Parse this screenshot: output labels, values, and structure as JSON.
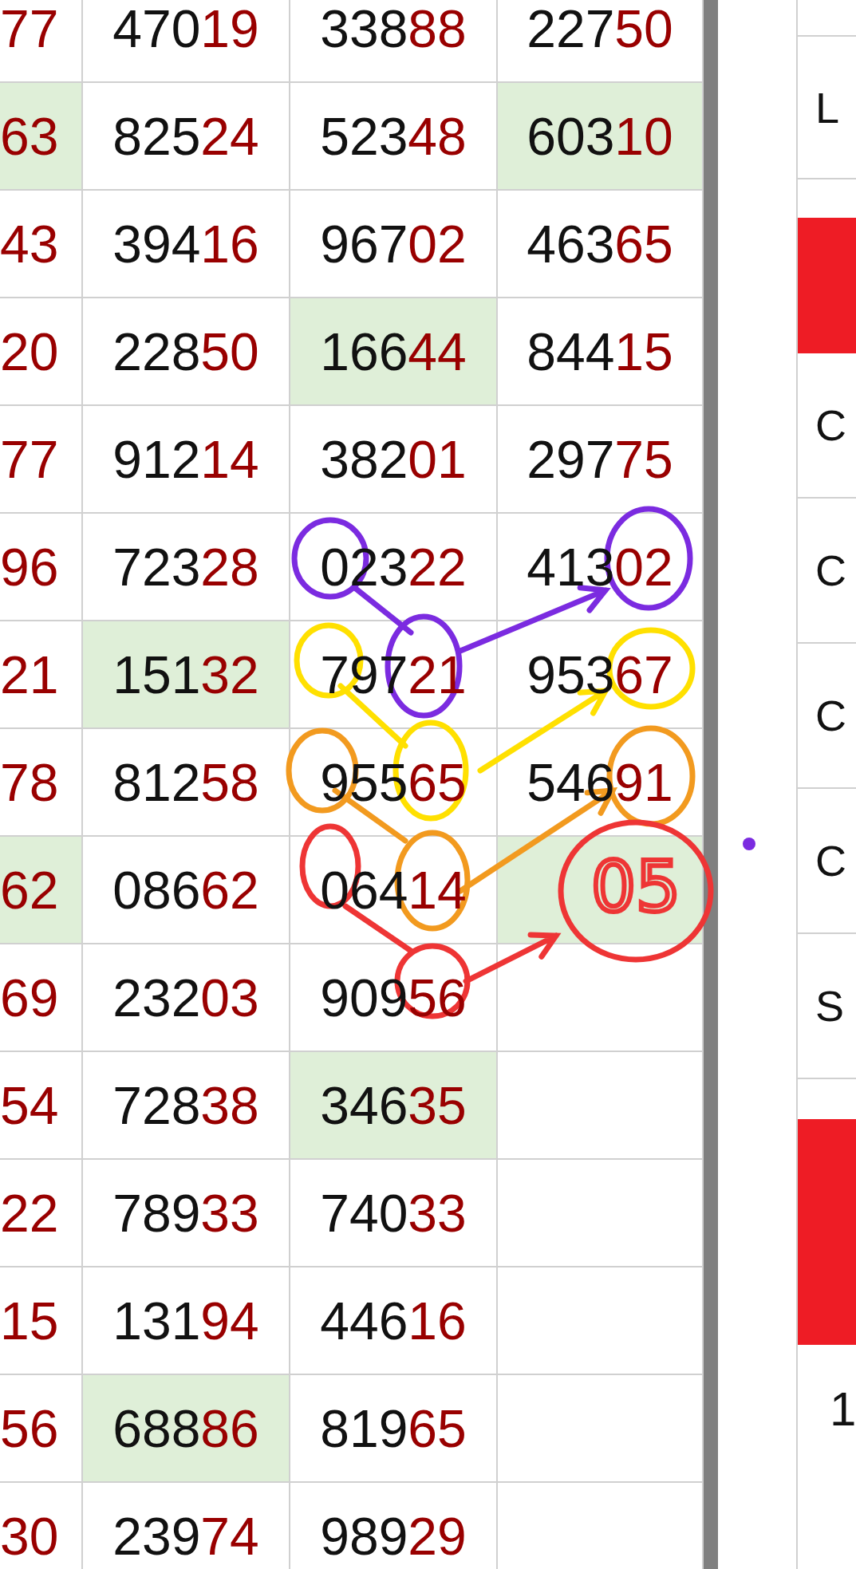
{
  "table": {
    "rows": [
      {
        "cells": [
          {
            "tail": "77",
            "highlighted": false
          },
          {
            "head": "470",
            "tail": "19",
            "highlighted": false
          },
          {
            "head": "338",
            "tail": "88",
            "highlighted": false
          },
          {
            "head": "227",
            "tail": "50",
            "highlighted": false
          }
        ]
      },
      {
        "cells": [
          {
            "tail": "63",
            "highlighted": true
          },
          {
            "head": "825",
            "tail": "24",
            "highlighted": false
          },
          {
            "head": "523",
            "tail": "48",
            "highlighted": false
          },
          {
            "head": "603",
            "tail": "10",
            "highlighted": true
          }
        ]
      },
      {
        "cells": [
          {
            "tail": "43",
            "highlighted": false
          },
          {
            "head": "394",
            "tail": "16",
            "highlighted": false
          },
          {
            "head": "967",
            "tail": "02",
            "highlighted": false
          },
          {
            "head": "463",
            "tail": "65",
            "highlighted": false
          }
        ]
      },
      {
        "cells": [
          {
            "tail": "20",
            "highlighted": false
          },
          {
            "head": "228",
            "tail": "50",
            "highlighted": false
          },
          {
            "head": "166",
            "tail": "44",
            "highlighted": true
          },
          {
            "head": "844",
            "tail": "15",
            "highlighted": false
          }
        ]
      },
      {
        "cells": [
          {
            "tail": "77",
            "highlighted": false
          },
          {
            "head": "912",
            "tail": "14",
            "highlighted": false
          },
          {
            "head": "382",
            "tail": "01",
            "highlighted": false
          },
          {
            "head": "297",
            "tail": "75",
            "highlighted": false
          }
        ]
      },
      {
        "cells": [
          {
            "tail": "96",
            "highlighted": false
          },
          {
            "head": "723",
            "tail": "28",
            "highlighted": false
          },
          {
            "head": "023",
            "tail": "22",
            "highlighted": false
          },
          {
            "head": "413",
            "tail": "02",
            "highlighted": false
          }
        ]
      },
      {
        "cells": [
          {
            "tail": "21",
            "highlighted": false
          },
          {
            "head": "151",
            "tail": "32",
            "highlighted": true
          },
          {
            "head": "797",
            "tail": "21",
            "highlighted": false
          },
          {
            "head": "953",
            "tail": "67",
            "highlighted": false
          }
        ]
      },
      {
        "cells": [
          {
            "tail": "78",
            "highlighted": false
          },
          {
            "head": "812",
            "tail": "58",
            "highlighted": false
          },
          {
            "head": "955",
            "tail": "65",
            "highlighted": false
          },
          {
            "head": "546",
            "tail": "91",
            "highlighted": false
          }
        ]
      },
      {
        "cells": [
          {
            "tail": "62",
            "highlighted": true
          },
          {
            "head": "086",
            "tail": "62",
            "highlighted": false
          },
          {
            "head": "064",
            "tail": "14",
            "highlighted": false
          },
          {
            "highlighted": true
          }
        ]
      },
      {
        "cells": [
          {
            "tail": "69",
            "highlighted": false
          },
          {
            "head": "232",
            "tail": "03",
            "highlighted": false
          },
          {
            "head": "909",
            "tail": "56",
            "highlighted": false
          },
          {
            "highlighted": false
          }
        ]
      },
      {
        "cells": [
          {
            "tail": "54",
            "highlighted": false
          },
          {
            "head": "728",
            "tail": "38",
            "highlighted": false
          },
          {
            "head": "346",
            "tail": "35",
            "highlighted": true
          },
          {
            "highlighted": false
          }
        ]
      },
      {
        "cells": [
          {
            "tail": "22",
            "highlighted": false
          },
          {
            "head": "789",
            "tail": "33",
            "highlighted": false
          },
          {
            "head": "740",
            "tail": "33",
            "highlighted": false
          },
          {
            "highlighted": false
          }
        ]
      },
      {
        "cells": [
          {
            "tail": "15",
            "highlighted": false
          },
          {
            "head": "131",
            "tail": "94",
            "highlighted": false
          },
          {
            "head": "446",
            "tail": "16",
            "highlighted": false
          },
          {
            "highlighted": false
          }
        ]
      },
      {
        "cells": [
          {
            "tail": "56",
            "highlighted": false
          },
          {
            "head": "688",
            "tail": "86",
            "highlighted": true
          },
          {
            "head": "819",
            "tail": "65",
            "highlighted": false
          },
          {
            "highlighted": false
          }
        ]
      },
      {
        "cells": [
          {
            "tail": "30",
            "highlighted": false
          },
          {
            "head": "239",
            "tail": "74",
            "highlighted": false
          },
          {
            "head": "989",
            "tail": "29",
            "highlighted": false
          },
          {
            "highlighted": false
          }
        ]
      }
    ]
  },
  "annotation": {
    "handwritten_number": "05"
  },
  "side_panel": {
    "box_label": "L",
    "rows": [
      "C",
      "C",
      "C",
      "C",
      "S"
    ],
    "bottom_cell": "1"
  }
}
